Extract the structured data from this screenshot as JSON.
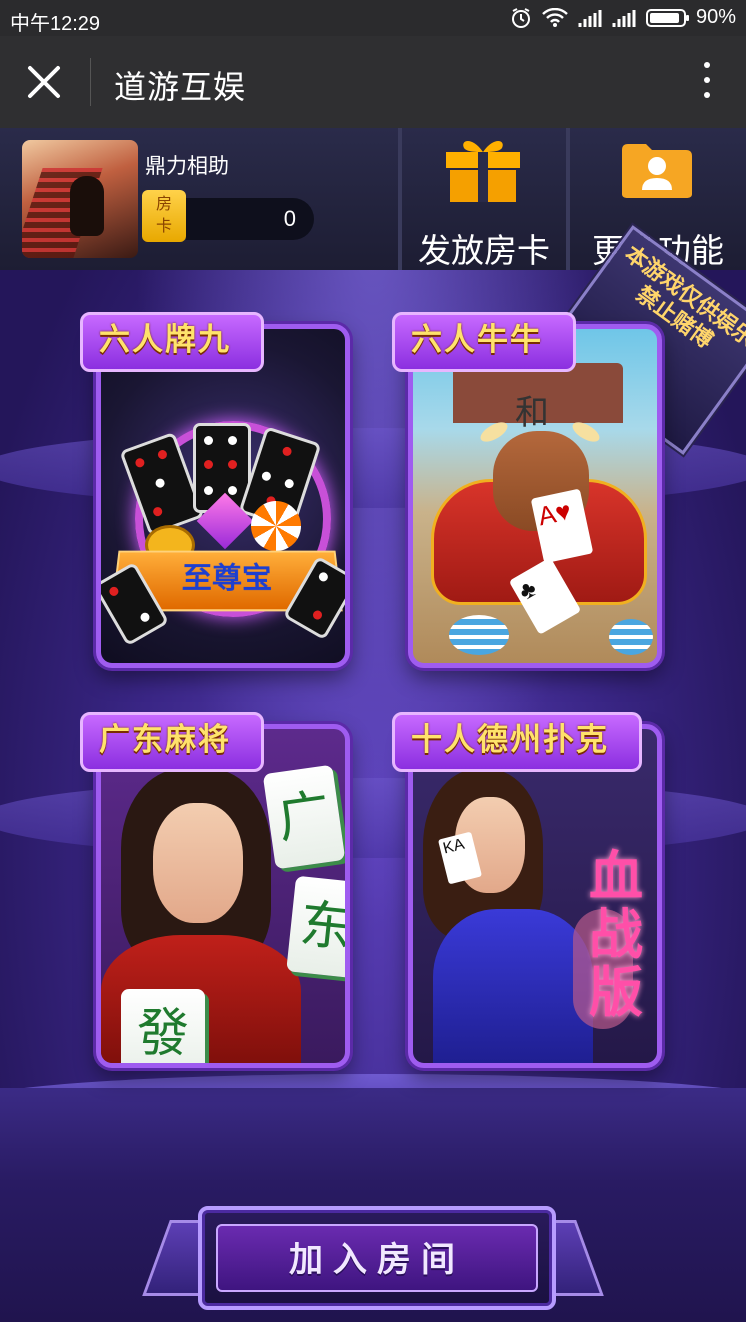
{
  "status_bar": {
    "time": "中午12:29",
    "battery": "90%",
    "battery_level": 0.9,
    "icons": [
      "alarm-icon",
      "wifi-icon",
      "signal-icon",
      "signal-icon",
      "battery-icon"
    ]
  },
  "nav": {
    "title": "道游互娱",
    "close_icon": "close-icon",
    "more_icon": "more-vertical-icon"
  },
  "user": {
    "name": "鼎力相助",
    "card_label": "房卡",
    "card_label_top": "房",
    "card_label_bottom": "卡",
    "card_count": "0"
  },
  "header_actions": [
    {
      "label": "发放房卡",
      "icon": "gift-icon"
    },
    {
      "label": "更多功能",
      "icon": "user-folder-icon"
    }
  ],
  "ribbon": {
    "text": "本游戏仅供娱乐禁止赌博"
  },
  "games": [
    {
      "title": "六人牌九",
      "art_text": "至尊宝"
    },
    {
      "title": "六人牛牛",
      "art_text": "和"
    },
    {
      "title": "广东麻将",
      "tiles": [
        "广",
        "东",
        "發"
      ]
    },
    {
      "title": "十人德州扑克",
      "art_text": "血战版"
    }
  ],
  "join_button": {
    "label": "加入房间"
  },
  "colors": {
    "accent_purple": "#9f5cf0",
    "tag_text_gold": "#ffe36b",
    "header_bg": "#2a2b4a",
    "status_bar_bg": "#2b2b2d"
  }
}
